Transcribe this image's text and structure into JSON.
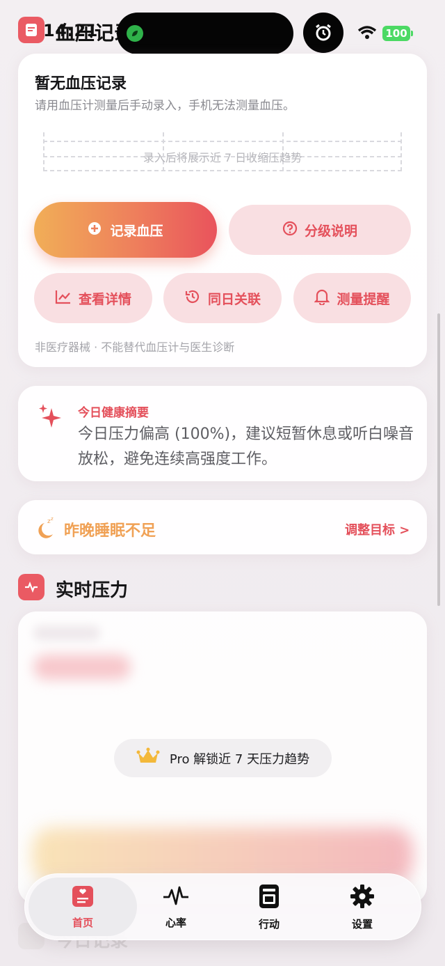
{
  "status_bar": {
    "time": "14:21",
    "battery": "100"
  },
  "top_section": {
    "title": "血压记录"
  },
  "bp_card": {
    "title": "暂无血压记录",
    "subtitle": "请用血压计测量后手动录入，手机无法测量血压。",
    "chart_hint": "录入后将展示近 7 日收缩压趋势",
    "record_button": "记录血压",
    "grade_button": "分级说明",
    "detail_button": "查看详情",
    "same_day_button": "同日关联",
    "remind_button": "测量提醒",
    "disclaimer": "非医疗器械 · 不能替代血压计与医生诊断"
  },
  "summary": {
    "label": "今日健康摘要",
    "text": "今日压力偏高 (100%)，建议短暂休息或听白噪音放松，避免连续高强度工作。"
  },
  "sleep": {
    "text": "昨晚睡眠不足",
    "link": "调整目标 >"
  },
  "stress_section": {
    "title": "实时压力",
    "pro_text": "Pro 解锁近 7 天压力趋势"
  },
  "tabs": [
    {
      "label": "首页"
    },
    {
      "label": "心率"
    },
    {
      "label": "行动"
    },
    {
      "label": "设置"
    }
  ],
  "below_section": {
    "title": "今日记录"
  },
  "colors": {
    "accent": "#e4505b",
    "orange": "#f0a155",
    "soft_pink": "#f9dfe2"
  }
}
